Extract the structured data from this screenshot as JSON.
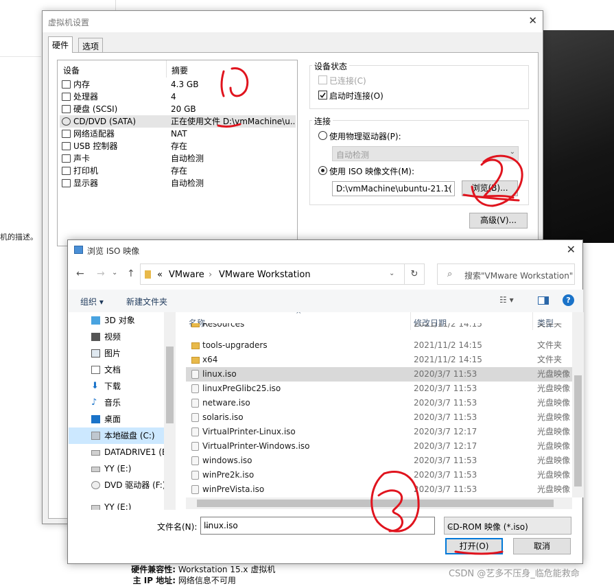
{
  "background": {
    "left_text": "机的描述。",
    "bottom": [
      {
        "label": "硬件兼容性:",
        "value": "Workstation 15.x 虚拟机"
      },
      {
        "label": "主 IP 地址:",
        "value": "网络信息不可用"
      }
    ],
    "watermark": "CSDN @艺多不压身_临危能救命"
  },
  "vm_dialog": {
    "title": "虚拟机设置",
    "tabs": [
      "硬件",
      "选项"
    ],
    "device_header": {
      "device": "设备",
      "summary": "摘要"
    },
    "devices": [
      {
        "name": "内存",
        "summary": "4.3 GB"
      },
      {
        "name": "处理器",
        "summary": "4"
      },
      {
        "name": "硬盘 (SCSI)",
        "summary": "20 GB"
      },
      {
        "name": "CD/DVD (SATA)",
        "summary": "正在使用文件 D:\\vmMachine\\u..."
      },
      {
        "name": "网络适配器",
        "summary": "NAT"
      },
      {
        "name": "USB 控制器",
        "summary": "存在"
      },
      {
        "name": "声卡",
        "summary": "自动检测"
      },
      {
        "name": "打印机",
        "summary": "存在"
      },
      {
        "name": "显示器",
        "summary": "自动检测"
      }
    ],
    "device_status": {
      "label": "设备状态",
      "connected": "已连接(C)",
      "connect_at_power_on": "启动时连接(O)"
    },
    "connection": {
      "label": "连接",
      "physical_drive": "使用物理驱动器(P):",
      "physical_drive_value": "自动检测",
      "iso_image": "使用 ISO 映像文件(M):",
      "iso_path": "D:\\vmMachine\\ubuntu-21.1(",
      "browse": "浏览(B)...",
      "advanced": "高级(V)..."
    }
  },
  "file_dialog": {
    "title": "浏览 ISO 映像",
    "breadcrumb": [
      "«",
      "VMware",
      "›",
      "VMware Workstation"
    ],
    "search_placeholder": "搜索\"VMware Workstation\"",
    "toolbar": {
      "organize": "组织 ▾",
      "new_folder": "新建文件夹"
    },
    "nav_items": [
      "3D 对象",
      "视频",
      "图片",
      "文档",
      "下载",
      "音乐",
      "桌面",
      "本地磁盘 (C:)",
      "DATADRIVE1 (E",
      "YY (E:)",
      "DVD 驱动器 (F:)",
      "YY (E:)"
    ],
    "columns": {
      "name": "名称",
      "date": "修改日期",
      "type": "类型"
    },
    "files": [
      {
        "name": "Resources",
        "date": "2021/11/2 14:15",
        "type": "文件夹",
        "kind": "folder"
      },
      {
        "name": "tools-upgraders",
        "date": "2021/11/2 14:15",
        "type": "文件夹",
        "kind": "folder"
      },
      {
        "name": "x64",
        "date": "2021/11/2 14:15",
        "type": "文件夹",
        "kind": "folder"
      },
      {
        "name": "linux.iso",
        "date": "2020/3/7 11:53",
        "type": "光盘映像",
        "kind": "iso"
      },
      {
        "name": "linuxPreGlibc25.iso",
        "date": "2020/3/7 11:53",
        "type": "光盘映像",
        "kind": "iso"
      },
      {
        "name": "netware.iso",
        "date": "2020/3/7 11:53",
        "type": "光盘映像",
        "kind": "iso"
      },
      {
        "name": "solaris.iso",
        "date": "2020/3/7 11:53",
        "type": "光盘映像",
        "kind": "iso"
      },
      {
        "name": "VirtualPrinter-Linux.iso",
        "date": "2020/3/7 12:17",
        "type": "光盘映像",
        "kind": "iso"
      },
      {
        "name": "VirtualPrinter-Windows.iso",
        "date": "2020/3/7 12:17",
        "type": "光盘映像",
        "kind": "iso"
      },
      {
        "name": "windows.iso",
        "date": "2020/3/7 11:53",
        "type": "光盘映像",
        "kind": "iso"
      },
      {
        "name": "winPre2k.iso",
        "date": "2020/3/7 11:53",
        "type": "光盘映像",
        "kind": "iso"
      },
      {
        "name": "winPreVista.iso",
        "date": "2020/3/7 11:53",
        "type": "光盘映像",
        "kind": "iso"
      }
    ],
    "filename_label": "文件名(N):",
    "filename_value": "linux.iso",
    "filetype": "CD-ROM 映像 (*.iso)",
    "open": "打开(O)",
    "cancel": "取消"
  },
  "annotations": {
    "color": "#e0141e"
  }
}
